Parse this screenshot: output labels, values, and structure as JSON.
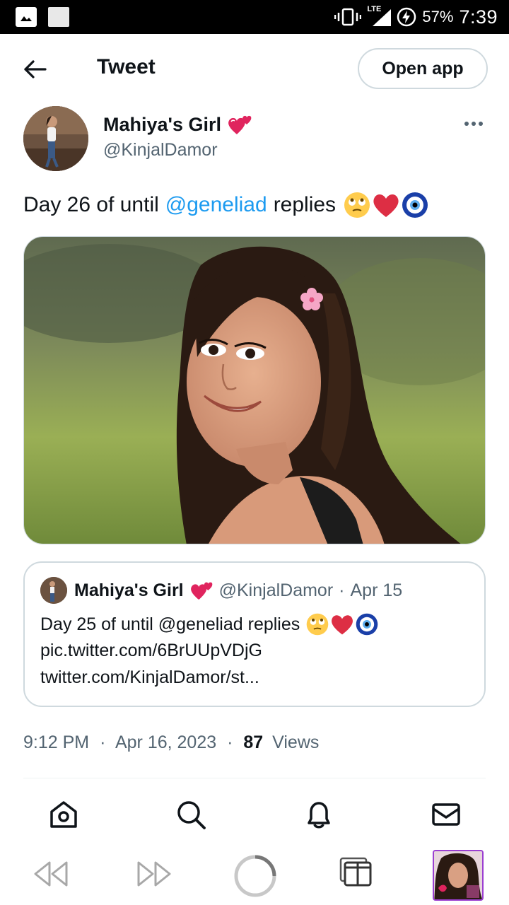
{
  "status_bar": {
    "network": "LTE",
    "battery": "57%",
    "time": "7:39"
  },
  "header": {
    "title": "Tweet",
    "open_app_label": "Open app"
  },
  "tweet": {
    "author_name": "Mahiya's Girl",
    "author_handle": "@KinjalDamor",
    "text_before": "Day 26 of until",
    "mention": "@geneliad",
    "text_after": "replies",
    "emojis": [
      "face-with-rolling-eyes",
      "red-heart",
      "nazar-amulet"
    ]
  },
  "quote": {
    "author_name": "Mahiya's Girl",
    "author_handle": "@KinjalDamor",
    "date": "Apr 15",
    "separator": "·",
    "line1": "Day 25 of until @geneliad replies",
    "line2": "pic.twitter.com/6BrUUpVDjG",
    "line3": "twitter.com/KinjalDamor/st..."
  },
  "meta": {
    "time": "9:12 PM",
    "separator": "·",
    "date": "Apr 16, 2023",
    "views_count": "87",
    "views_label": "Views"
  },
  "bottom_nav": [
    "home-icon",
    "search-icon",
    "notifications-icon",
    "messages-icon"
  ],
  "browser_bar": [
    "back-icon",
    "forward-icon",
    "reload-icon",
    "tabs-icon",
    "tab-thumbnail"
  ],
  "colors": {
    "accent": "#1d9bf0",
    "text": "#0f1419",
    "muted": "#536471",
    "border": "#cfd9de"
  }
}
